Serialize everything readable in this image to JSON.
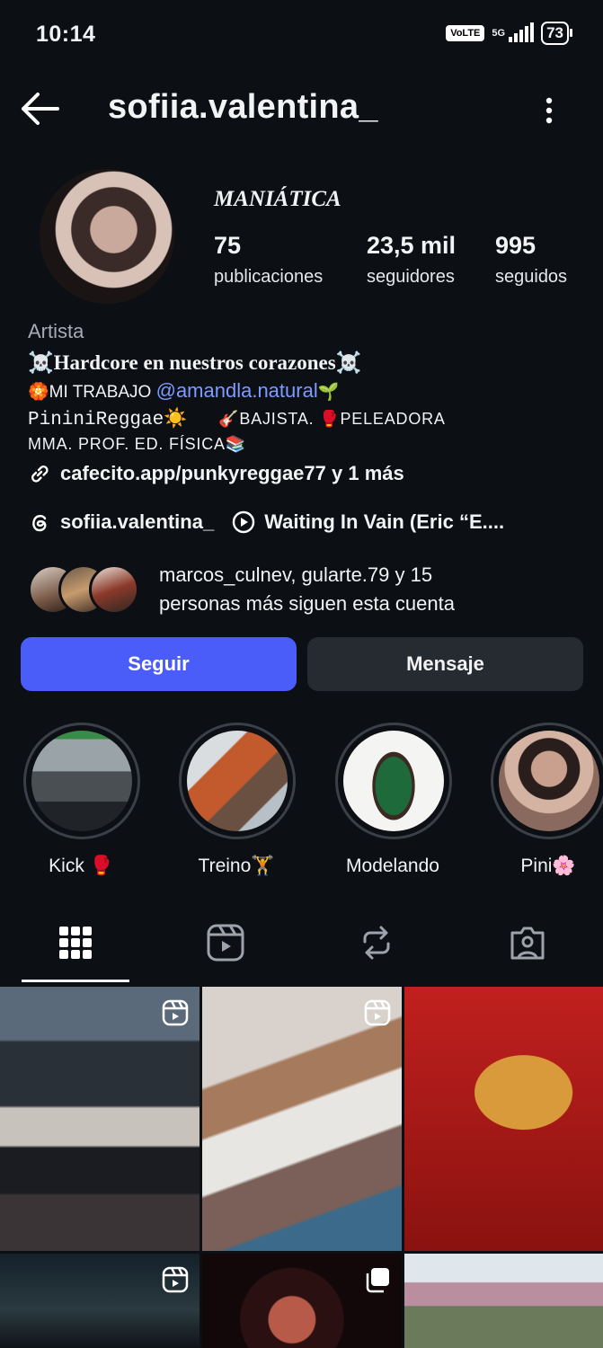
{
  "status_bar": {
    "time": "10:14",
    "volte": "VoLTE",
    "network": "5G",
    "battery": "73"
  },
  "header": {
    "username": "sofiia.valentina_"
  },
  "profile": {
    "display_name": "MANIÁTICA",
    "stats": [
      {
        "value": "75",
        "label": "publicaciones"
      },
      {
        "value": "23,5 mil",
        "label": "seguidores"
      },
      {
        "value": "995",
        "label": "seguidos"
      }
    ],
    "category": "Artista",
    "bio_line1": "☠️Hardcore en nuestros corazones☠️",
    "bio_line2_prefix": "🏵️MI TRABAJO ",
    "bio_mention": "@amandla.natural",
    "bio_line2_suffix": "🌱",
    "bio_line3_mono": "PininiReggae☀️",
    "bio_line3_rest": "🎸BAJISTA.   🥊PELEADORA",
    "bio_line4": "MMA.   PROF. ED. FÍSICA📚",
    "link": "cafecito.app/punkyreggae77 y 1 más",
    "threads_handle": "sofiia.valentina_",
    "music": "Waiting In Vain (Eric “E....",
    "followed_by_line1": "marcos_culnev, gularte.79 y 15",
    "followed_by_line2": "personas más siguen esta cuenta"
  },
  "actions": {
    "follow": "Seguir",
    "message": "Mensaje"
  },
  "highlights": [
    {
      "label": "Kick 🥊"
    },
    {
      "label": "Treino🏋️"
    },
    {
      "label": "Modelando"
    },
    {
      "label": "Pini🌸"
    }
  ],
  "colors": {
    "background": "#0c0f14",
    "accent_blue": "#4a5df9",
    "mention_blue": "#7c9cff",
    "secondary_button": "#262a31"
  },
  "tabs": [
    "grid-icon",
    "reels-icon",
    "reposts-icon",
    "tagged-icon"
  ]
}
